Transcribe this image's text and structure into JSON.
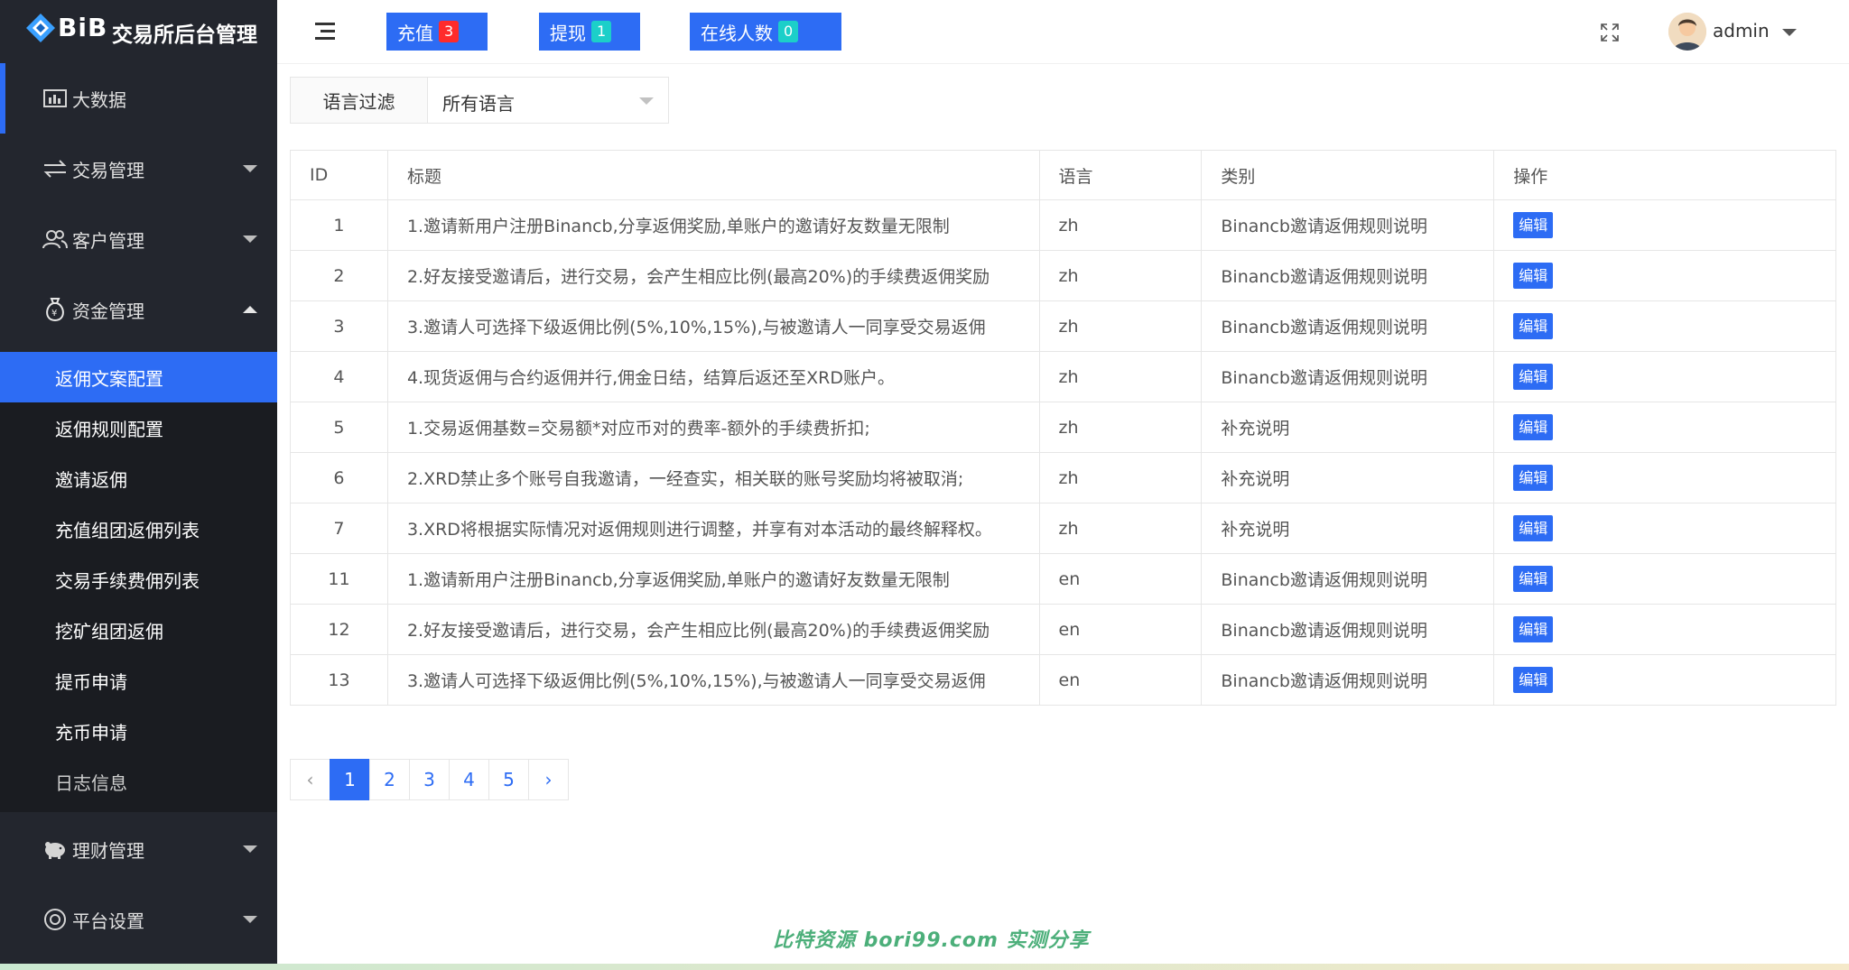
{
  "brand": {
    "logo_text": "BiB",
    "title": "交易所后台管理"
  },
  "sidebar": {
    "items": [
      {
        "label": "大数据",
        "icon": "chart-icon"
      },
      {
        "label": "交易管理",
        "icon": "exchange-icon"
      },
      {
        "label": "客户管理",
        "icon": "users-icon"
      },
      {
        "label": "资金管理",
        "icon": "money-bag-icon"
      },
      {
        "label": "理财管理",
        "icon": "piggy-bank-icon"
      },
      {
        "label": "平台设置",
        "icon": "settings-icon"
      }
    ],
    "submenu": [
      "返佣文案配置",
      "返佣规则配置",
      "邀请返佣",
      "充值组团返佣列表",
      "交易手续费佣列表",
      "挖矿组团返佣",
      "提币申请",
      "充币申请",
      "日志信息"
    ]
  },
  "header": {
    "recharge": {
      "label": "充值",
      "count": "3"
    },
    "withdraw": {
      "label": "提现",
      "count": "1"
    },
    "online": {
      "label": "在线人数",
      "count": "0"
    },
    "user": "admin"
  },
  "filter": {
    "label": "语言过滤",
    "value": "所有语言"
  },
  "table": {
    "headers": [
      "ID",
      "标题",
      "语言",
      "类别",
      "操作"
    ],
    "edit_label": "编辑",
    "rows": [
      {
        "id": "1",
        "title": "1.邀请新用户注册Binancb,分享返佣奖励,单账户的邀请好友数量无限制",
        "lang": "zh",
        "category": "Binancb邀请返佣规则说明"
      },
      {
        "id": "2",
        "title": "2.好友接受邀请后，进行交易，会产生相应比例(最高20%)的手续费返佣奖励",
        "lang": "zh",
        "category": "Binancb邀请返佣规则说明"
      },
      {
        "id": "3",
        "title": "3.邀请人可选择下级返佣比例(5%,10%,15%),与被邀请人一同享受交易返佣",
        "lang": "zh",
        "category": "Binancb邀请返佣规则说明"
      },
      {
        "id": "4",
        "title": "4.现货返佣与合约返佣并行,佣金日结，结算后返还至XRD账户。",
        "lang": "zh",
        "category": "Binancb邀请返佣规则说明"
      },
      {
        "id": "5",
        "title": "1.交易返佣基数=交易额*对应币对的费率-额外的手续费折扣;",
        "lang": "zh",
        "category": "补充说明"
      },
      {
        "id": "6",
        "title": "2.XRD禁止多个账号自我邀请，一经查实，相关联的账号奖励均将被取消;",
        "lang": "zh",
        "category": "补充说明"
      },
      {
        "id": "7",
        "title": "3.XRD将根据实际情况对返佣规则进行调整，并享有对本活动的最终解释权。",
        "lang": "zh",
        "category": "补充说明"
      },
      {
        "id": "11",
        "title": "1.邀请新用户注册Binancb,分享返佣奖励,单账户的邀请好友数量无限制",
        "lang": "en",
        "category": "Binancb邀请返佣规则说明"
      },
      {
        "id": "12",
        "title": "2.好友接受邀请后，进行交易，会产生相应比例(最高20%)的手续费返佣奖励",
        "lang": "en",
        "category": "Binancb邀请返佣规则说明"
      },
      {
        "id": "13",
        "title": "3.邀请人可选择下级返佣比例(5%,10%,15%),与被邀请人一同享受交易返佣",
        "lang": "en",
        "category": "Binancb邀请返佣规则说明"
      }
    ]
  },
  "pagination": {
    "prev": "‹",
    "pages": [
      "1",
      "2",
      "3",
      "4",
      "5"
    ],
    "next": "›",
    "current": "1"
  },
  "watermark": "比特资源 bori99.com 实测分享",
  "colors": {
    "sidebar_bg": "#23262e",
    "accent": "#2d6cf4",
    "badge_red": "#ff2b2b",
    "badge_cyan": "#1ccfc9"
  }
}
